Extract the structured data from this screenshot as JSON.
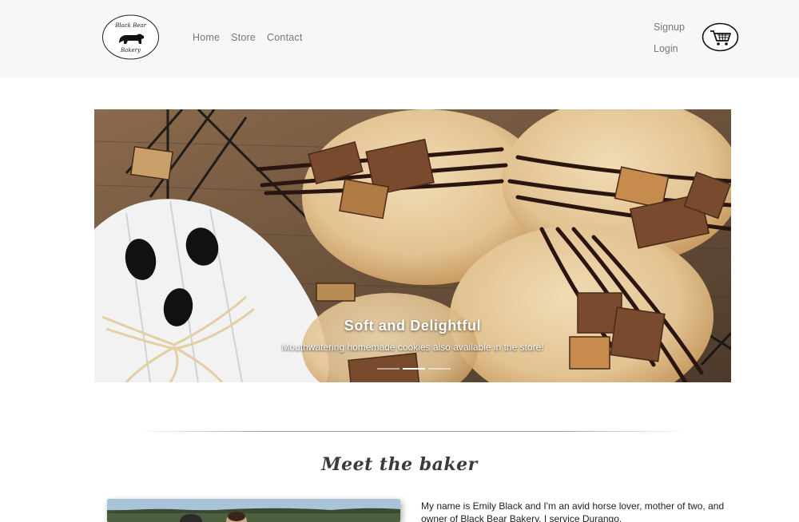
{
  "logo": {
    "line1": "Black Bear",
    "line2": "Bakery"
  },
  "nav": {
    "home": "Home",
    "store": "Store",
    "contact": "Contact"
  },
  "auth": {
    "signup": "Signup",
    "login": "Login"
  },
  "cart": {
    "icon": "shopping-cart-icon"
  },
  "hero": {
    "title": "Soft and Delightful",
    "text": "Mouthwatering homemade cookies also available in the store!",
    "slides": 3,
    "active_slide": 2
  },
  "meet": {
    "title": "Meet the baker",
    "bio": "My name is Emily Black and I'm an avid horse lover, mother of two, and owner of Black Bear Bakery. I service Durango,"
  },
  "colors": {
    "navbar_bg": "#f7f7f8",
    "nav_text": "#777777",
    "heading": "#3a3a3a"
  }
}
